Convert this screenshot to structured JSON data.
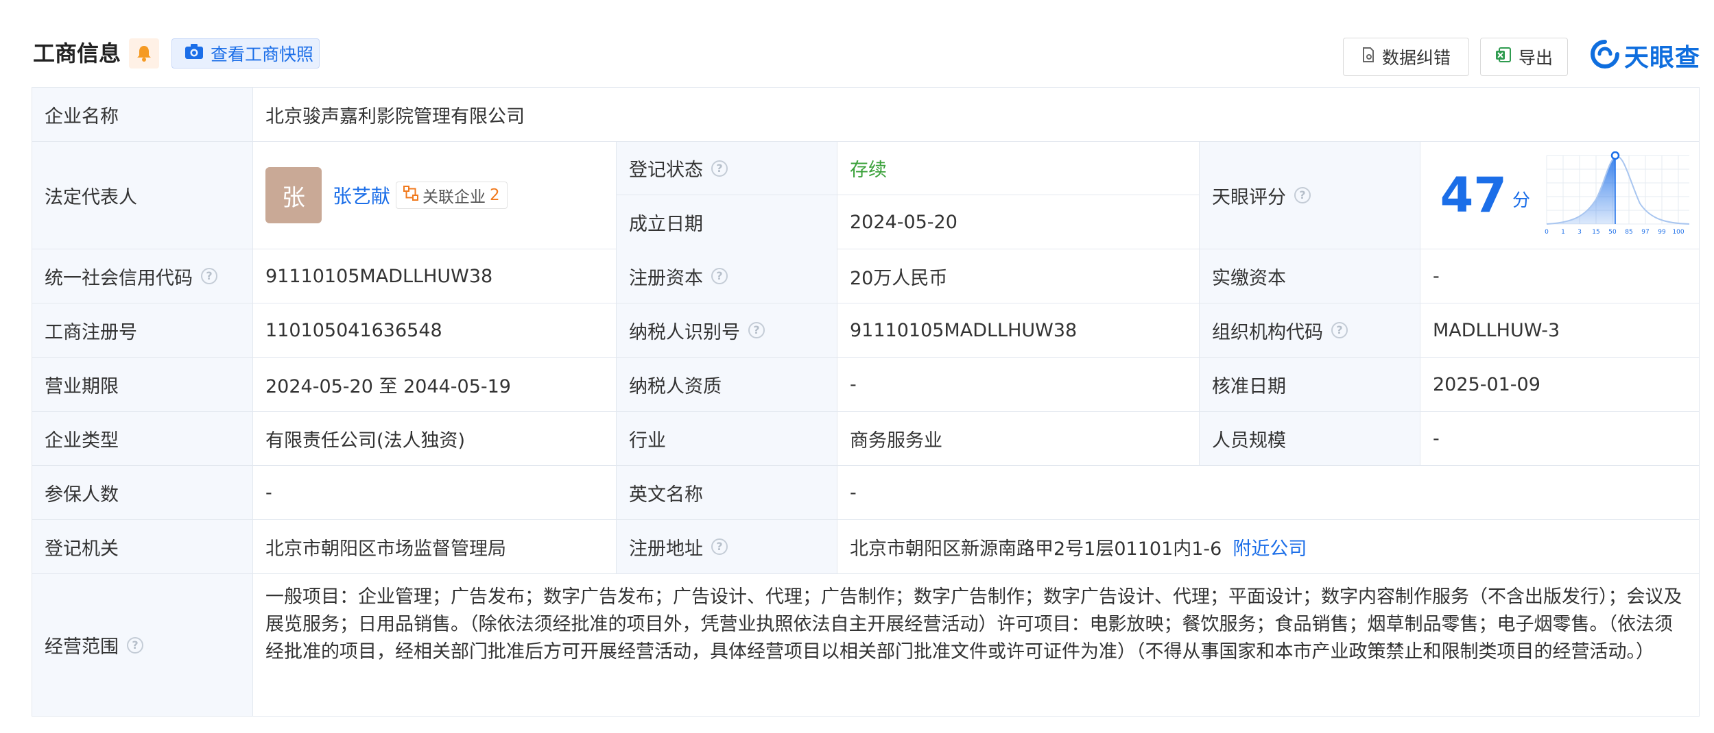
{
  "header": {
    "title": "工商信息",
    "snapshot_label": "查看工商快照",
    "correction_label": "数据纠错",
    "export_label": "导出",
    "logo_text": "天眼查"
  },
  "row_company": {
    "label": "企业名称",
    "value": "北京骏声嘉利影院管理有限公司"
  },
  "row_legal": {
    "label": "法定代表人",
    "avatar_char": "张",
    "name": "张艺献",
    "related_label": "关联企业",
    "related_count": "2",
    "reg_status_label": "登记状态",
    "reg_status_value": "存续",
    "founded_label": "成立日期",
    "founded_value": "2024-05-20",
    "score_label": "天眼评分",
    "score_value": "47",
    "score_unit": "分",
    "score_ticks": [
      "0",
      "1",
      "3",
      "15",
      "50",
      "85",
      "97",
      "99",
      "100"
    ]
  },
  "rows": [
    {
      "l1": "统一社会信用代码",
      "v1": "91110105MADLLHUW38",
      "l2": "注册资本",
      "v2": "20万人民币",
      "l3": "实缴资本",
      "v3": "-"
    },
    {
      "l1": "工商注册号",
      "v1": "110105041636548",
      "l2": "纳税人识别号",
      "v2": "91110105MADLLHUW38",
      "l3": "组织机构代码",
      "v3": "MADLLHUW-3"
    },
    {
      "l1": "营业期限",
      "v1": "2024-05-20 至 2044-05-19",
      "l2": "纳税人资质",
      "v2": "-",
      "l3": "核准日期",
      "v3": "2025-01-09"
    },
    {
      "l1": "企业类型",
      "v1": "有限责任公司(法人独资)",
      "l2": "行业",
      "v2": "商务服务业",
      "l3": "人员规模",
      "v3": "-"
    }
  ],
  "row_insured": {
    "l1": "参保人数",
    "v1": "-",
    "l2": "英文名称",
    "v2": "-"
  },
  "row_authority": {
    "l1": "登记机关",
    "v1": "北京市朝阳区市场监督管理局",
    "l2": "注册地址",
    "v2": "北京市朝阳区新源南路甲2号1层01101内1-6",
    "nearby": "附近公司"
  },
  "row_scope": {
    "label": "经营范围",
    "value": "一般项目：企业管理；广告发布；数字广告发布；广告设计、代理；广告制作；数字广告制作；数字广告设计、代理；平面设计；数字内容制作服务（不含出版发行）；会议及展览服务；日用品销售。（除依法须经批准的项目外，凭营业执照依法自主开展经营活动）许可项目：电影放映；餐饮服务；食品销售；烟草制品零售；电子烟零售。（依法须经批准的项目，经相关部门批准后方可开展经营活动，具体经营项目以相关部门批准文件或许可证件为准）（不得从事国家和本市产业政策禁止和限制类项目的经营活动。）"
  },
  "colors": {
    "accent": "#1b6ee8",
    "label_bg": "#f5f8fd",
    "status_green": "#3aa13a",
    "orange": "#f07a1e"
  }
}
